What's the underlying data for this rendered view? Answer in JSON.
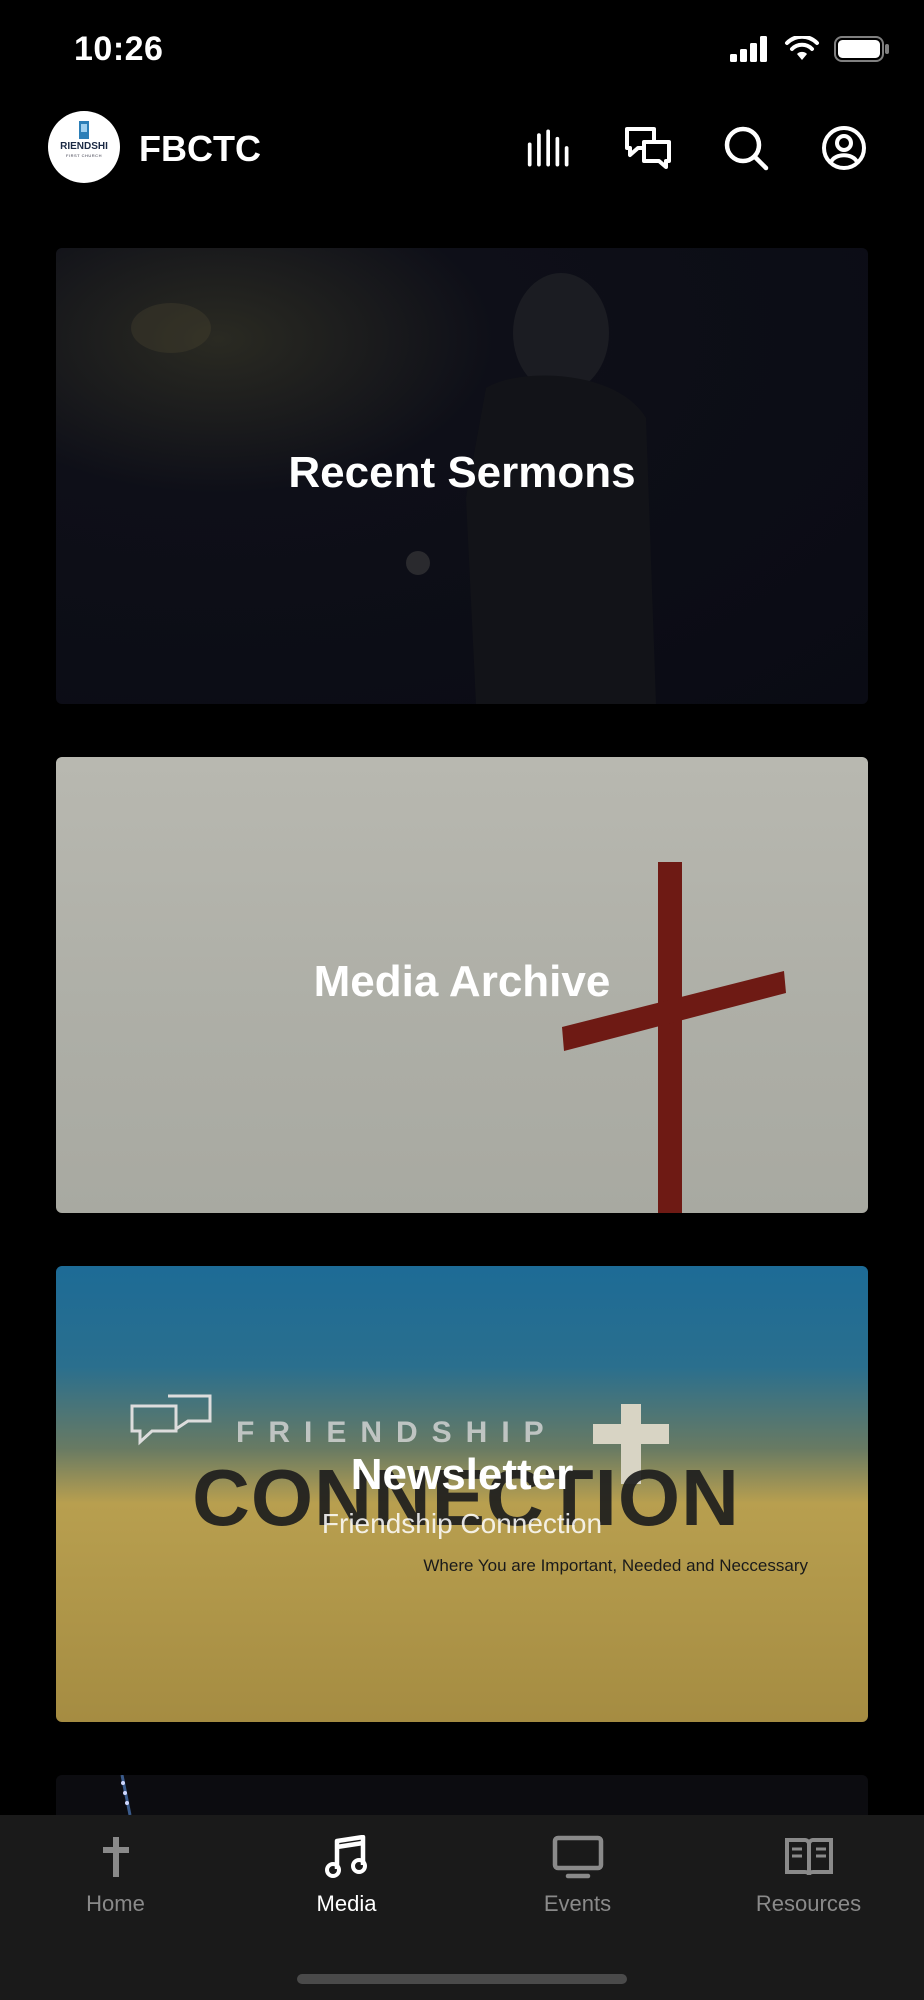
{
  "status_bar": {
    "time": "10:26"
  },
  "header": {
    "logo_text": "RIENDSHI",
    "logo_subtext": "FIRST CHURCH",
    "brand": "FBCTC",
    "icons": [
      "bars-icon",
      "chat-icon",
      "search-icon",
      "profile-icon"
    ]
  },
  "cards": {
    "sermons": {
      "title": "Recent Sermons"
    },
    "archive": {
      "title": "Media Archive"
    },
    "newsletter": {
      "title": "Newsletter",
      "subtitle": "Friendship Connection",
      "art_word1": "FRIENDSHIP",
      "art_word2": "CONNECTION",
      "art_tagline": "Where You are Important, Needed and Neccessary"
    }
  },
  "tabs": [
    {
      "label": "Home",
      "icon": "cross-icon",
      "active": false
    },
    {
      "label": "Media",
      "icon": "music-note-icon",
      "active": true
    },
    {
      "label": "Events",
      "icon": "tv-icon",
      "active": false
    },
    {
      "label": "Resources",
      "icon": "book-icon",
      "active": false
    }
  ],
  "colors": {
    "background": "#000000",
    "tab_bar": "#1a1a1a",
    "tab_inactive": "#8a8a8a",
    "tab_active": "#ffffff"
  }
}
